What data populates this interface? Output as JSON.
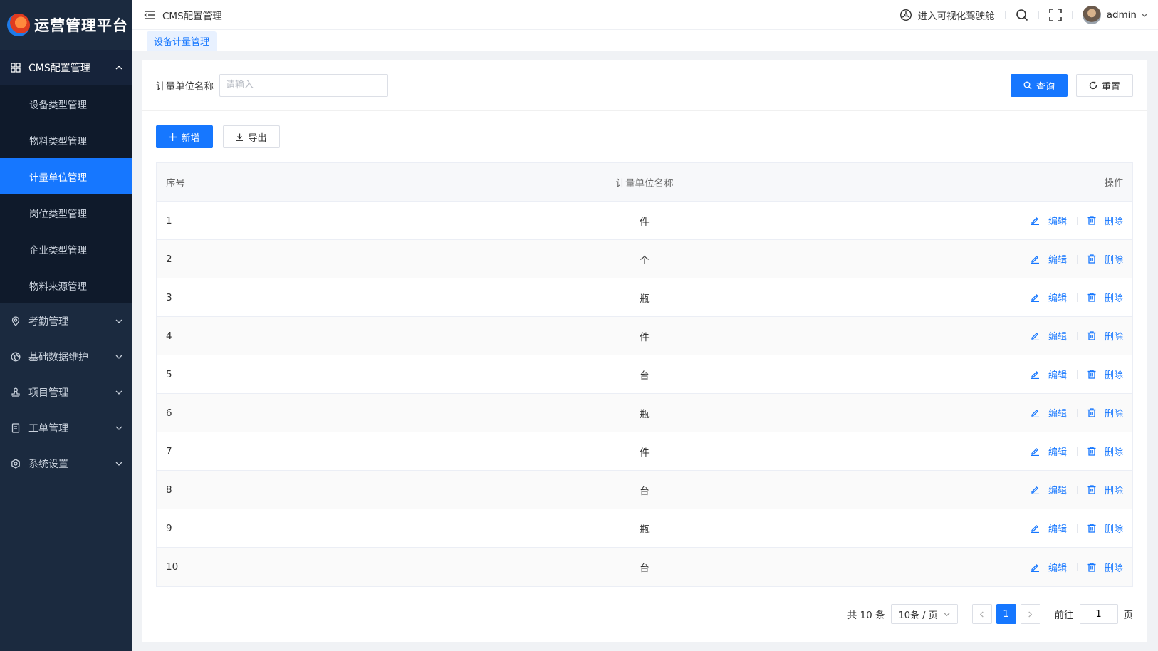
{
  "app": {
    "logo_text": "运营管理平台"
  },
  "sidebar": {
    "groups": [
      {
        "label": "CMS配置管理",
        "icon": "grid-icon",
        "expanded": true,
        "items": [
          {
            "label": "设备类型管理"
          },
          {
            "label": "物料类型管理"
          },
          {
            "label": "计量单位管理",
            "active": true
          },
          {
            "label": "岗位类型管理"
          },
          {
            "label": "企业类型管理"
          },
          {
            "label": "物料来源管理"
          }
        ]
      },
      {
        "label": "考勤管理",
        "icon": "location-pin-icon"
      },
      {
        "label": "基础数据维护",
        "icon": "globe-icon"
      },
      {
        "label": "项目管理",
        "icon": "stamp-icon"
      },
      {
        "label": "工单管理",
        "icon": "document-icon"
      },
      {
        "label": "系统设置",
        "icon": "gear-icon"
      }
    ]
  },
  "header": {
    "breadcrumb": "CMS配置管理",
    "cockpit_label": "进入可视化驾驶舱",
    "user_name": "admin"
  },
  "tabs": [
    {
      "label": "设备计量管理"
    }
  ],
  "search": {
    "field_label": "计量单位名称",
    "placeholder": "请输入",
    "value": "",
    "query_label": "查询",
    "reset_label": "重置"
  },
  "toolbar": {
    "add_label": "新增",
    "export_label": "导出"
  },
  "table": {
    "columns": [
      "序号",
      "计量单位名称",
      "操作"
    ],
    "edit_label": "编辑",
    "delete_label": "删除",
    "rows": [
      {
        "index": "1",
        "name": "件"
      },
      {
        "index": "2",
        "name": "个"
      },
      {
        "index": "3",
        "name": "瓶"
      },
      {
        "index": "4",
        "name": "件"
      },
      {
        "index": "5",
        "name": "台"
      },
      {
        "index": "6",
        "name": "瓶"
      },
      {
        "index": "7",
        "name": "件"
      },
      {
        "index": "8",
        "name": "台"
      },
      {
        "index": "9",
        "name": "瓶"
      },
      {
        "index": "10",
        "name": "台"
      }
    ]
  },
  "pagination": {
    "total_text": "共 10 条",
    "page_size": "10条 / 页",
    "current_page": "1",
    "goto_prefix": "前往",
    "goto_value": "1",
    "goto_suffix": "页"
  },
  "colors": {
    "primary": "#1677ff",
    "sidebar_bg": "#1b2a3f"
  }
}
